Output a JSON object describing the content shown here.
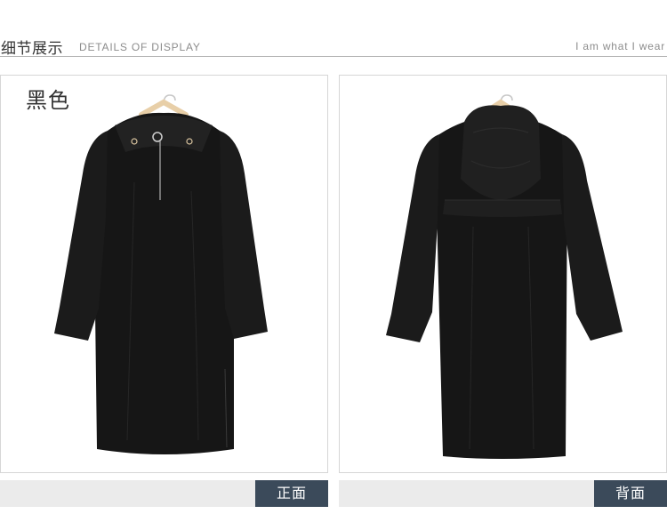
{
  "header": {
    "title_cn": "细节展示",
    "title_en": "DETAILS OF DISPLAY",
    "tagline": "I am what I wear"
  },
  "panels": {
    "front": {
      "color_label": "黑色",
      "caption": "正面",
      "image": "black hooded long dress, front view on hanger"
    },
    "back": {
      "caption": "背面",
      "image": "black hooded long dress, back view on hanger"
    }
  },
  "colors": {
    "garment": "#161616",
    "caption_bg": "#3b4a5a",
    "bar_bg": "#ebebeb",
    "hanger": "#e8cfa8"
  }
}
